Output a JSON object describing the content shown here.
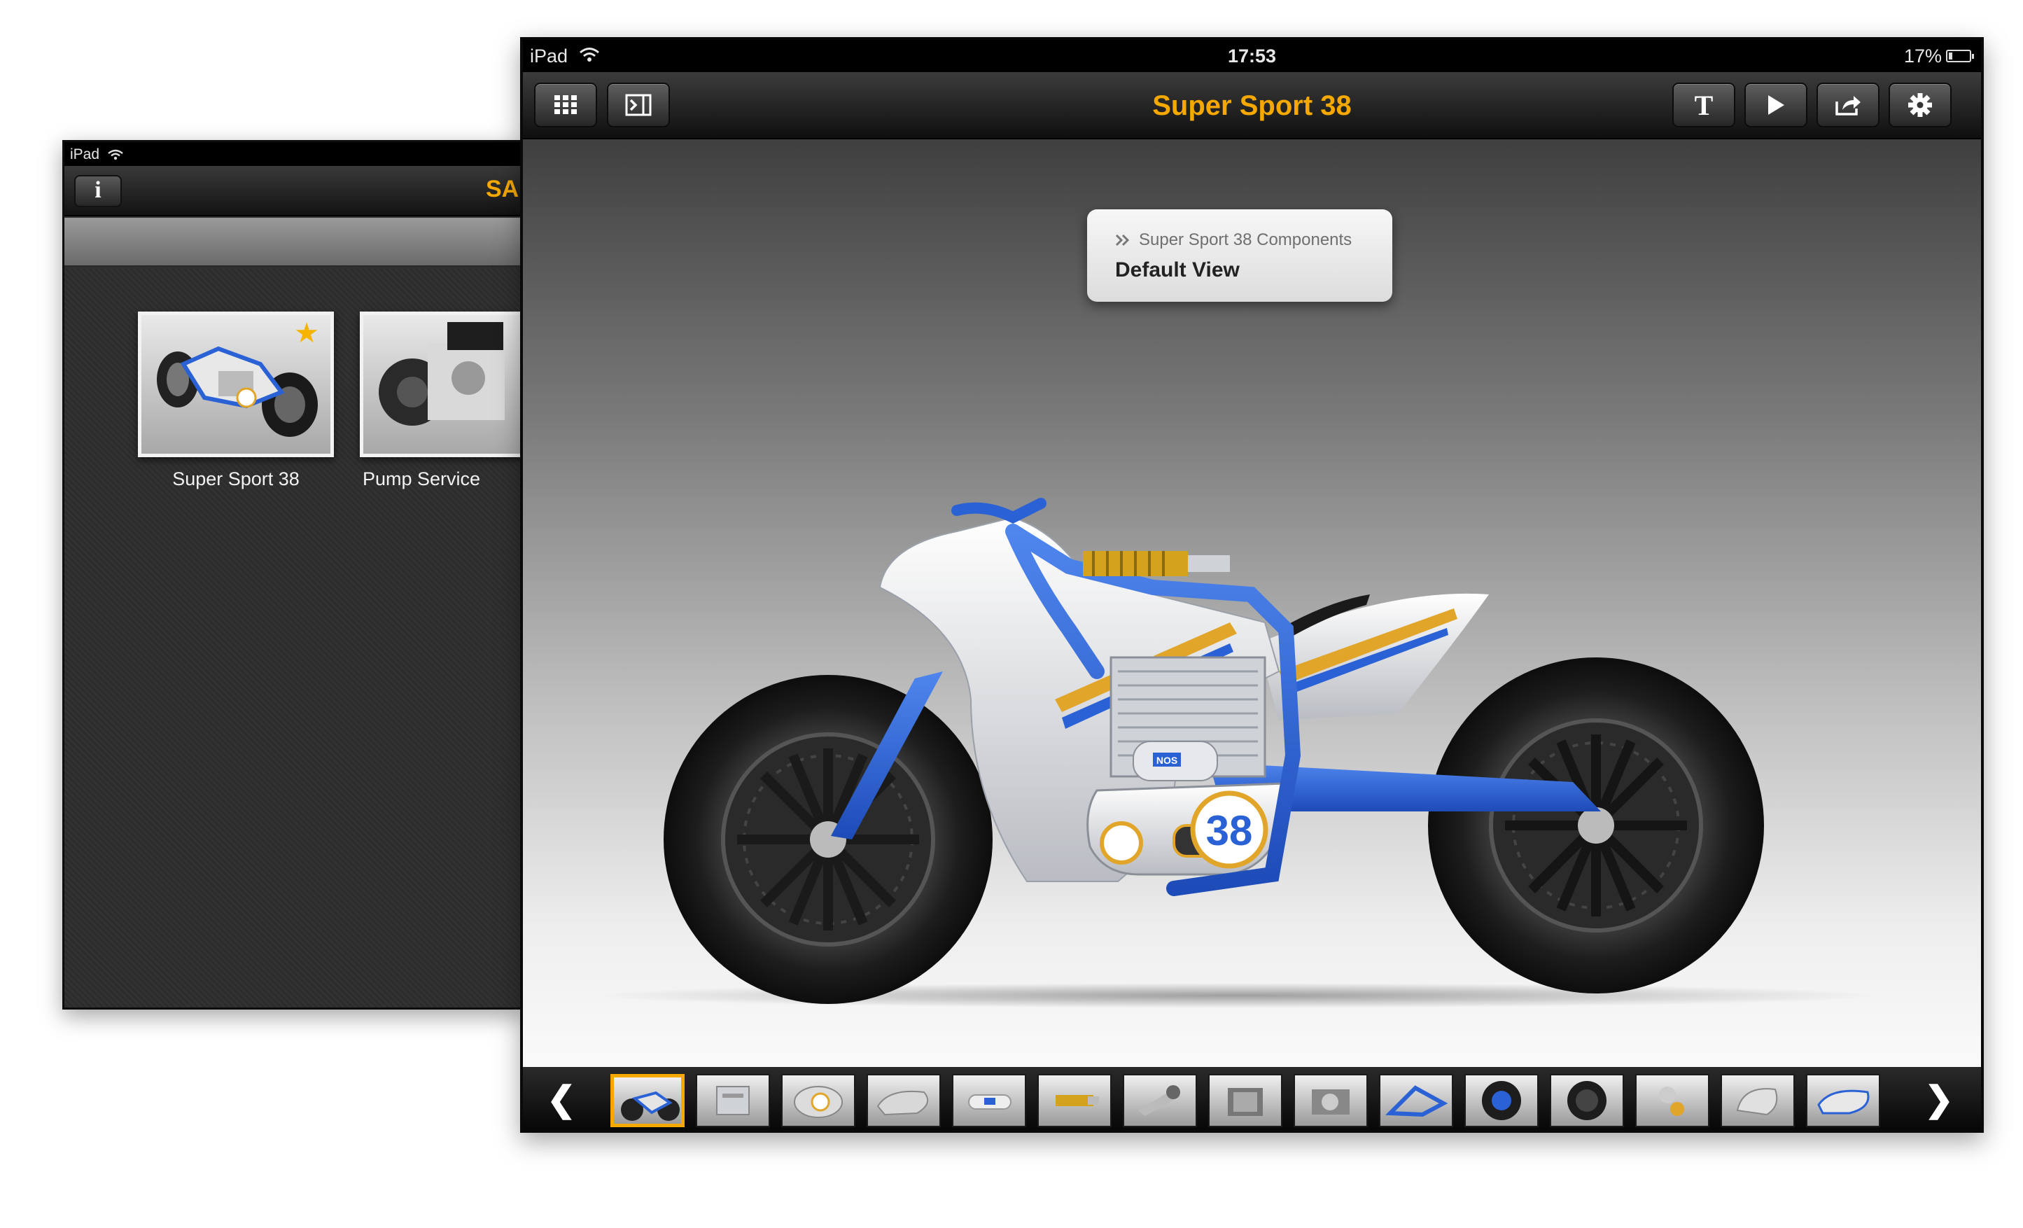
{
  "library": {
    "status_carrier": "iPad",
    "nav_title": "SA",
    "info_button_label": "i",
    "documents": [
      {
        "label": "Super Sport 38",
        "favorite": true
      },
      {
        "label": "Pump Service",
        "favorite": false
      }
    ]
  },
  "viewer": {
    "status": {
      "carrier": "iPad",
      "time": "17:53",
      "battery": "17%"
    },
    "title": "Super Sport 38",
    "toolbar": {
      "left_buttons": [
        "grid-icon",
        "sidebar-toggle-icon"
      ],
      "text_button_label": "T",
      "right_buttons": [
        "text-icon",
        "play-icon",
        "share-icon",
        "settings-gear-icon"
      ]
    },
    "breadcrumb": {
      "parent": "Super Sport 38 Components",
      "view_name": "Default View"
    },
    "model_decal_number": "38",
    "model_badge_text": "NOS",
    "thumbnails": {
      "prev_label": "❮",
      "next_label": "❯",
      "selected_index": 0,
      "items": [
        "full-bike-thumb",
        "engine-thumb",
        "cover-38-thumb",
        "engine-case-thumb",
        "nos-tank-thumb",
        "shock-absorber-thumb",
        "exhaust-thumb",
        "engine-block-thumb",
        "transmission-thumb",
        "frame-thumb",
        "front-wheel-thumb",
        "rear-wheel-thumb",
        "brake-parts-thumb",
        "tank-thumb",
        "fairing-thumb"
      ]
    },
    "colors": {
      "accent": "#f5a800",
      "frame_blue": "#2a62d6",
      "decal_gold": "#e1a52a"
    }
  }
}
